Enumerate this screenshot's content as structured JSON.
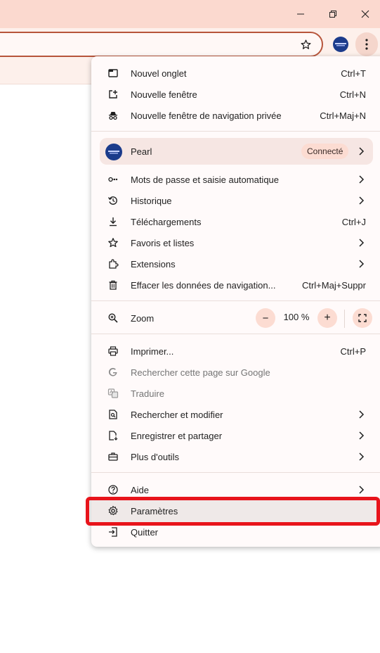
{
  "window": {
    "controls": [
      "minimize-icon",
      "restore-icon",
      "close-icon"
    ]
  },
  "toolbar": {
    "star_icon": "star-outline-icon",
    "menu_icon": "three-dots-vertical-icon"
  },
  "menu": {
    "group1": [
      {
        "label": "Nouvel onglet",
        "shortcut": "Ctrl+T",
        "icon": "new-tab-icon"
      },
      {
        "label": "Nouvelle fenêtre",
        "shortcut": "Ctrl+N",
        "icon": "new-window-icon"
      },
      {
        "label": "Nouvelle fenêtre de navigation privée",
        "shortcut": "Ctrl+Maj+N",
        "icon": "incognito-icon"
      }
    ],
    "profile": {
      "name": "Pearl",
      "status": "Connecté"
    },
    "group2": [
      {
        "label": "Mots de passe et saisie automatique",
        "shortcut": "",
        "icon": "key-icon"
      },
      {
        "label": "Historique",
        "shortcut": "",
        "icon": "history-icon"
      },
      {
        "label": "Téléchargements",
        "shortcut": "Ctrl+J",
        "icon": "download-icon"
      },
      {
        "label": "Favoris et listes",
        "shortcut": "",
        "icon": "star-icon"
      },
      {
        "label": "Extensions",
        "shortcut": "",
        "icon": "puzzle-icon"
      },
      {
        "label": "Effacer les données de navigation...",
        "shortcut": "Ctrl+Maj+Suppr",
        "icon": "trash-icon"
      }
    ],
    "zoom": {
      "label": "Zoom",
      "minus": "−",
      "value": "100 %",
      "plus": "+"
    },
    "group3": [
      {
        "label": "Imprimer...",
        "shortcut": "Ctrl+P",
        "icon": "print-icon"
      },
      {
        "label": "Rechercher cette page sur Google",
        "shortcut": "",
        "icon": "google-icon"
      },
      {
        "label": "Traduire",
        "shortcut": "",
        "icon": "translate-icon"
      },
      {
        "label": "Rechercher et modifier",
        "shortcut": "",
        "icon": "find-icon"
      },
      {
        "label": "Enregistrer et partager",
        "shortcut": "",
        "icon": "save-share-icon"
      },
      {
        "label": "Plus d'outils",
        "shortcut": "",
        "icon": "toolbox-icon"
      }
    ],
    "group4": [
      {
        "label": "Aide",
        "shortcut": "",
        "icon": "help-icon"
      },
      {
        "label": "Paramètres",
        "shortcut": "",
        "icon": "gear-icon"
      },
      {
        "label": "Quitter",
        "shortcut": "",
        "icon": "exit-icon"
      }
    ]
  },
  "colors": {
    "titlebar": "#fbd9cf",
    "toolbar": "#fdf0eb",
    "accent": "#b7553b",
    "highlight_box": "#e8141b"
  }
}
